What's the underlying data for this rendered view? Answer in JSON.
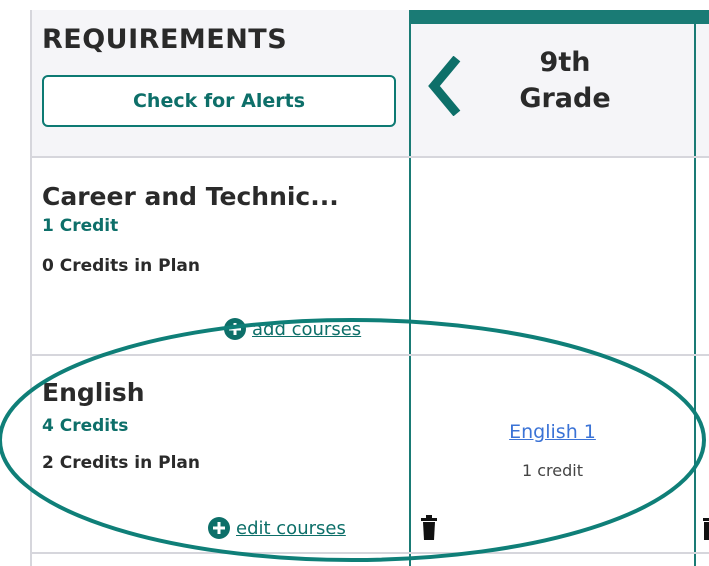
{
  "header": {
    "requirements_title": "REQUIREMENTS",
    "check_alerts_label": "Check for Alerts",
    "grade_label": "9th Grade",
    "chevron_icon": "chevron-left-icon"
  },
  "rows": [
    {
      "title": "Career and Technic...",
      "credits": "1 Credit",
      "in_plan": "0 Credits in Plan",
      "action_label": "add courses",
      "action_icon": "plus-circle-icon"
    },
    {
      "title": "English",
      "credits": "4 Credits",
      "in_plan": "2 Credits in Plan",
      "action_label": "edit courses",
      "action_icon": "plus-circle-icon",
      "course": {
        "name": "English 1",
        "credit": "1 credit"
      },
      "delete_icon": "trash-icon"
    }
  ],
  "colors": {
    "teal": "#0d6f69",
    "teal_border": "#1a7b75",
    "link_blue": "#3b73d6",
    "header_bg": "#f5f5f8"
  }
}
